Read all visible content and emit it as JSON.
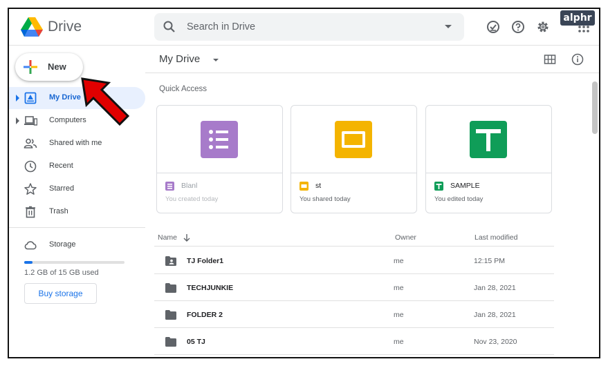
{
  "watermark": "alphr",
  "header": {
    "app_name": "Drive",
    "search_placeholder": "Search in Drive"
  },
  "sidebar": {
    "new_label": "New",
    "items": [
      {
        "label": "My Drive",
        "icon": "my-drive-icon",
        "active": true
      },
      {
        "label": "Computers",
        "icon": "computer-icon",
        "active": false
      },
      {
        "label": "Shared with me",
        "icon": "people-icon",
        "active": false
      },
      {
        "label": "Recent",
        "icon": "clock-icon",
        "active": false
      },
      {
        "label": "Starred",
        "icon": "star-icon",
        "active": false
      },
      {
        "label": "Trash",
        "icon": "trash-icon",
        "active": false
      }
    ],
    "storage": {
      "label": "Storage",
      "used_text": "1.2 GB of 15 GB used",
      "used_fraction": 0.08,
      "buy_label": "Buy storage"
    }
  },
  "main": {
    "title": "My Drive",
    "quick_access_label": "Quick Access",
    "cards": [
      {
        "name": "Blanl",
        "subtitle": "You created today",
        "type": "forms",
        "color": "#a77bca",
        "faded": true
      },
      {
        "name": "st",
        "subtitle": "You shared today",
        "type": "slides",
        "color": "#f4b400",
        "faded": false
      },
      {
        "name": "SAMPLE",
        "subtitle": "You edited today",
        "type": "sheets",
        "color": "#0f9d58",
        "faded": false
      }
    ],
    "columns": {
      "name": "Name",
      "owner": "Owner",
      "modified": "Last modified"
    },
    "rows": [
      {
        "name": "TJ Folder1",
        "owner": "me",
        "modified": "12:15 PM",
        "shared": true
      },
      {
        "name": "TECHJUNKIE",
        "owner": "me",
        "modified": "Jan 28, 2021",
        "shared": false
      },
      {
        "name": "FOLDER 2",
        "owner": "me",
        "modified": "Jan 28, 2021",
        "shared": false
      },
      {
        "name": "05 TJ",
        "owner": "me",
        "modified": "Nov 23, 2020",
        "shared": false
      }
    ]
  },
  "colors": {
    "accent": "#1a73e8",
    "active_bg": "#e8f0fe",
    "annotation_arrow": "#e00000"
  }
}
